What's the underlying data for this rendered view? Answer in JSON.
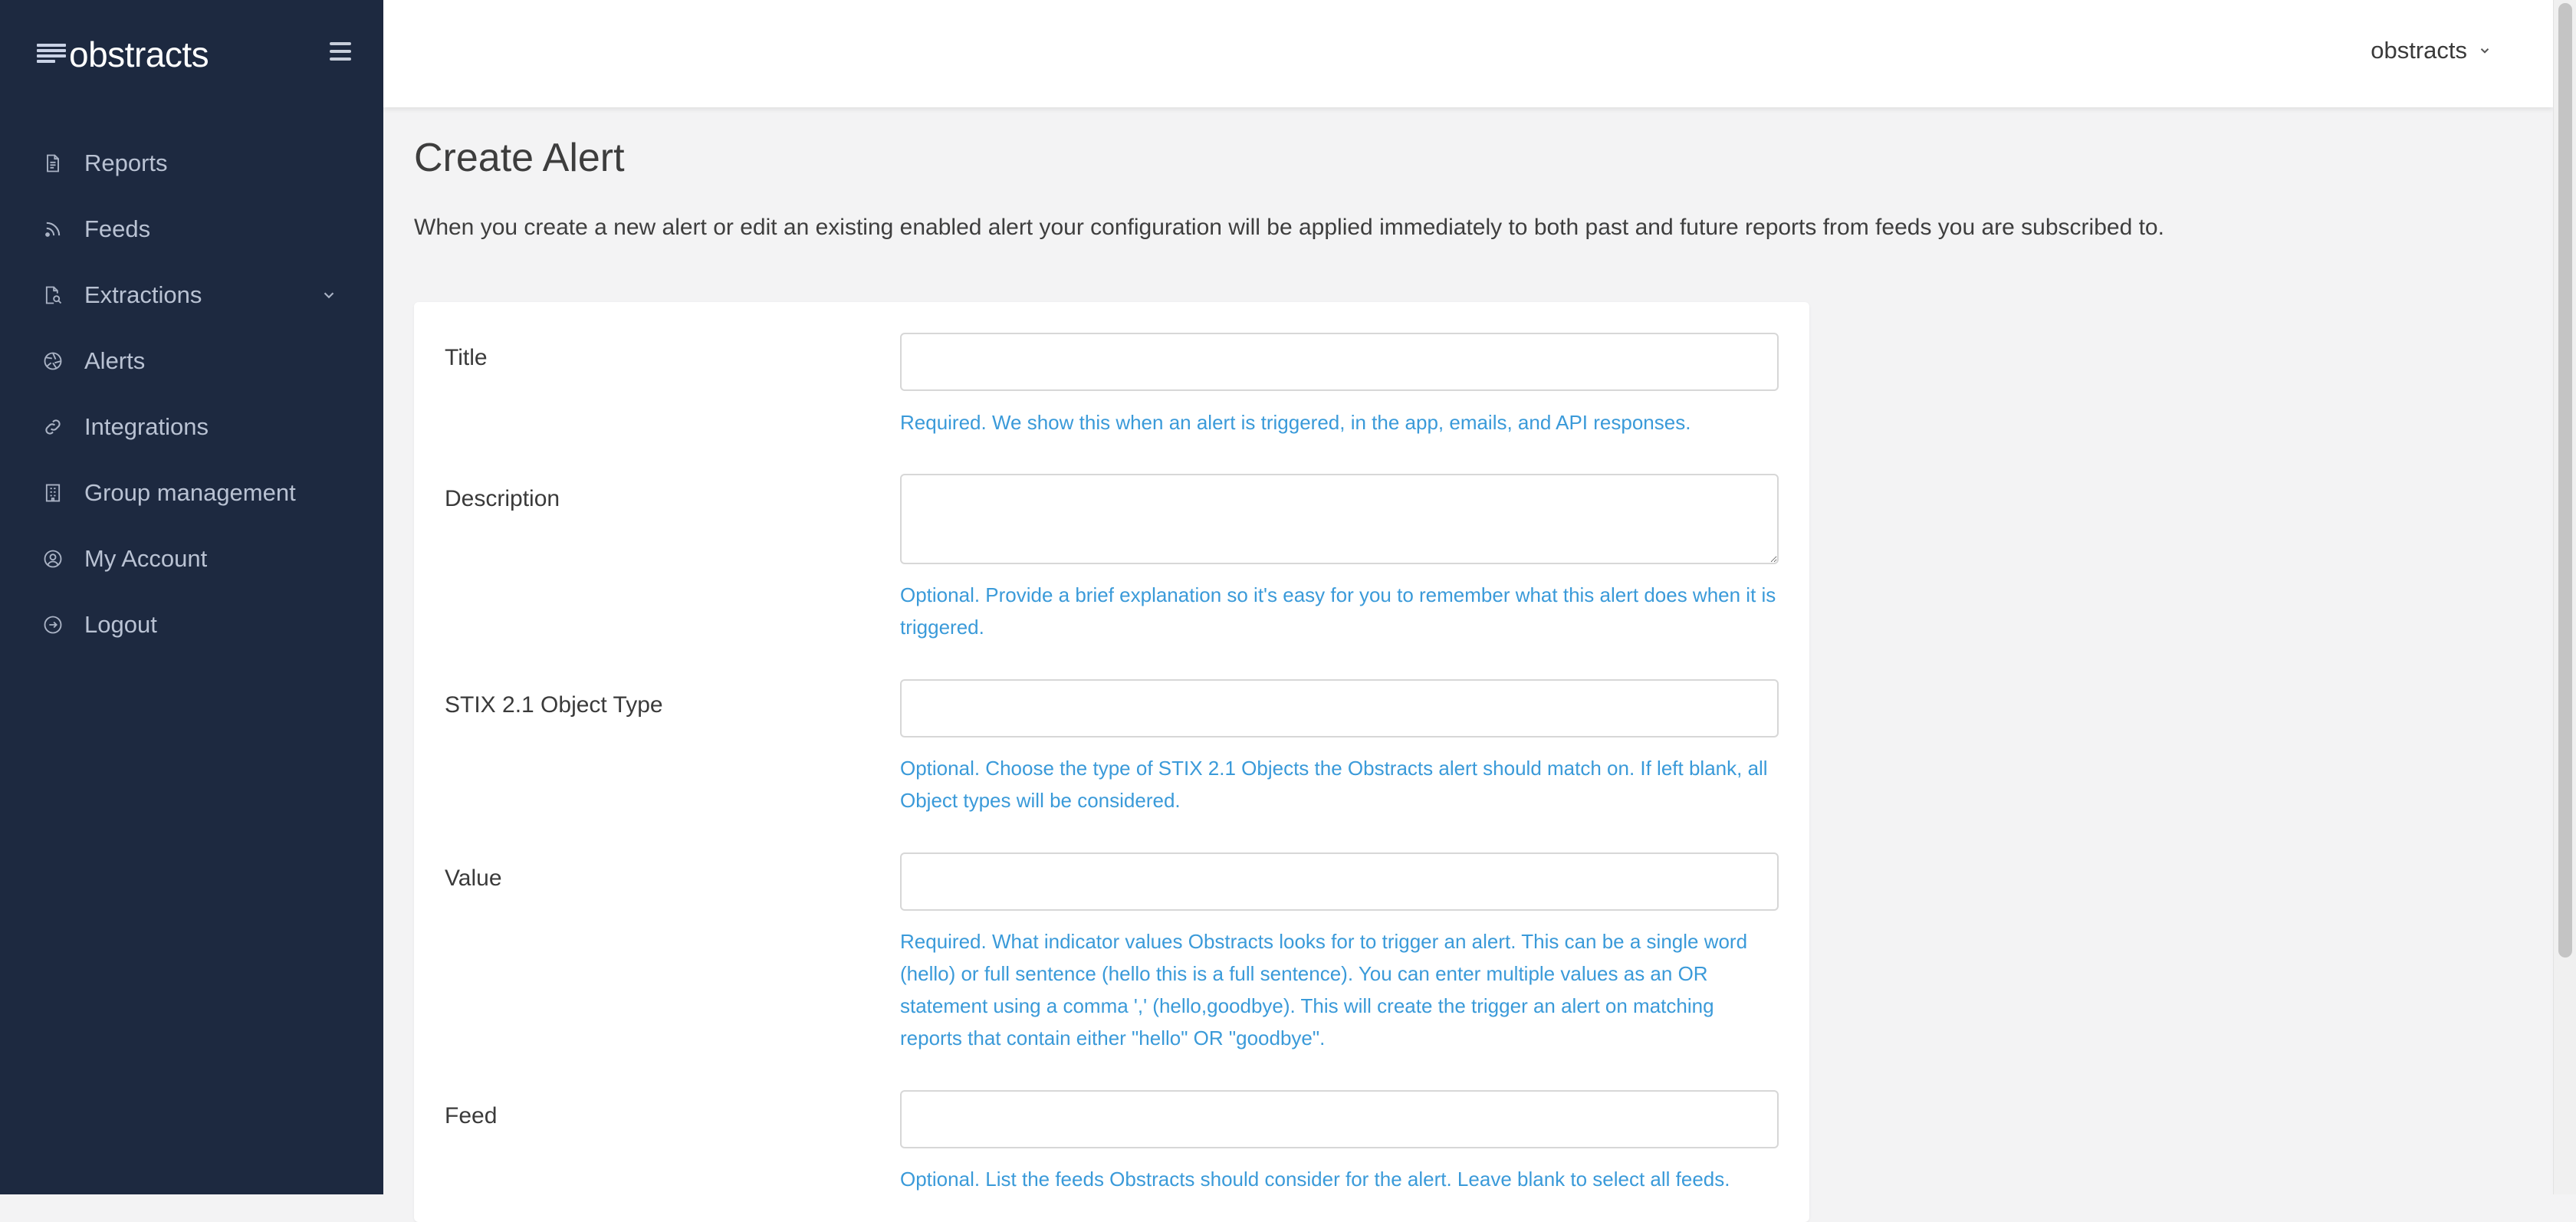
{
  "sidebar": {
    "brand": "obstracts",
    "items": [
      {
        "label": "Reports",
        "icon": "document-icon"
      },
      {
        "label": "Feeds",
        "icon": "rss-icon"
      },
      {
        "label": "Extractions",
        "icon": "search-document-icon",
        "expandable": true
      },
      {
        "label": "Alerts",
        "icon": "aperture-icon"
      },
      {
        "label": "Integrations",
        "icon": "link-icon"
      },
      {
        "label": "Group management",
        "icon": "building-icon"
      },
      {
        "label": "My Account",
        "icon": "user-circle-icon"
      },
      {
        "label": "Logout",
        "icon": "logout-icon"
      }
    ]
  },
  "header": {
    "user": "obstracts"
  },
  "main": {
    "title": "Create Alert",
    "intro": "When you create a new alert or edit an existing enabled alert your configuration will be applied immediately to both past and future reports from feeds you are subscribed to.",
    "form": {
      "title": {
        "label": "Title",
        "value": "",
        "help": "Required. We show this when an alert is triggered, in the app, emails, and API responses."
      },
      "description": {
        "label": "Description",
        "value": "",
        "help": "Optional. Provide a brief explanation so it's easy for you to remember what this alert does when it is triggered."
      },
      "stix_type": {
        "label": "STIX 2.1 Object Type",
        "value": "",
        "help": "Optional. Choose the type of STIX 2.1 Objects the Obstracts alert should match on. If left blank, all Object types will be considered."
      },
      "value": {
        "label": "Value",
        "value": "",
        "help": "Required. What indicator values Obstracts looks for to trigger an alert. This can be a single word (hello) or full sentence (hello this is a full sentence). You can enter multiple values as an OR statement using a comma ',' (hello,goodbye). This will create the trigger an alert on matching reports that contain either \"hello\" OR \"goodbye\"."
      },
      "feed": {
        "label": "Feed",
        "value": "",
        "help": "Optional. List the feeds Obstracts should consider for the alert. Leave blank to select all feeds."
      }
    }
  },
  "colors": {
    "sidebar_bg": "#1d2940",
    "help_text": "#3a9ad9",
    "page_bg": "#f3f3f4"
  }
}
